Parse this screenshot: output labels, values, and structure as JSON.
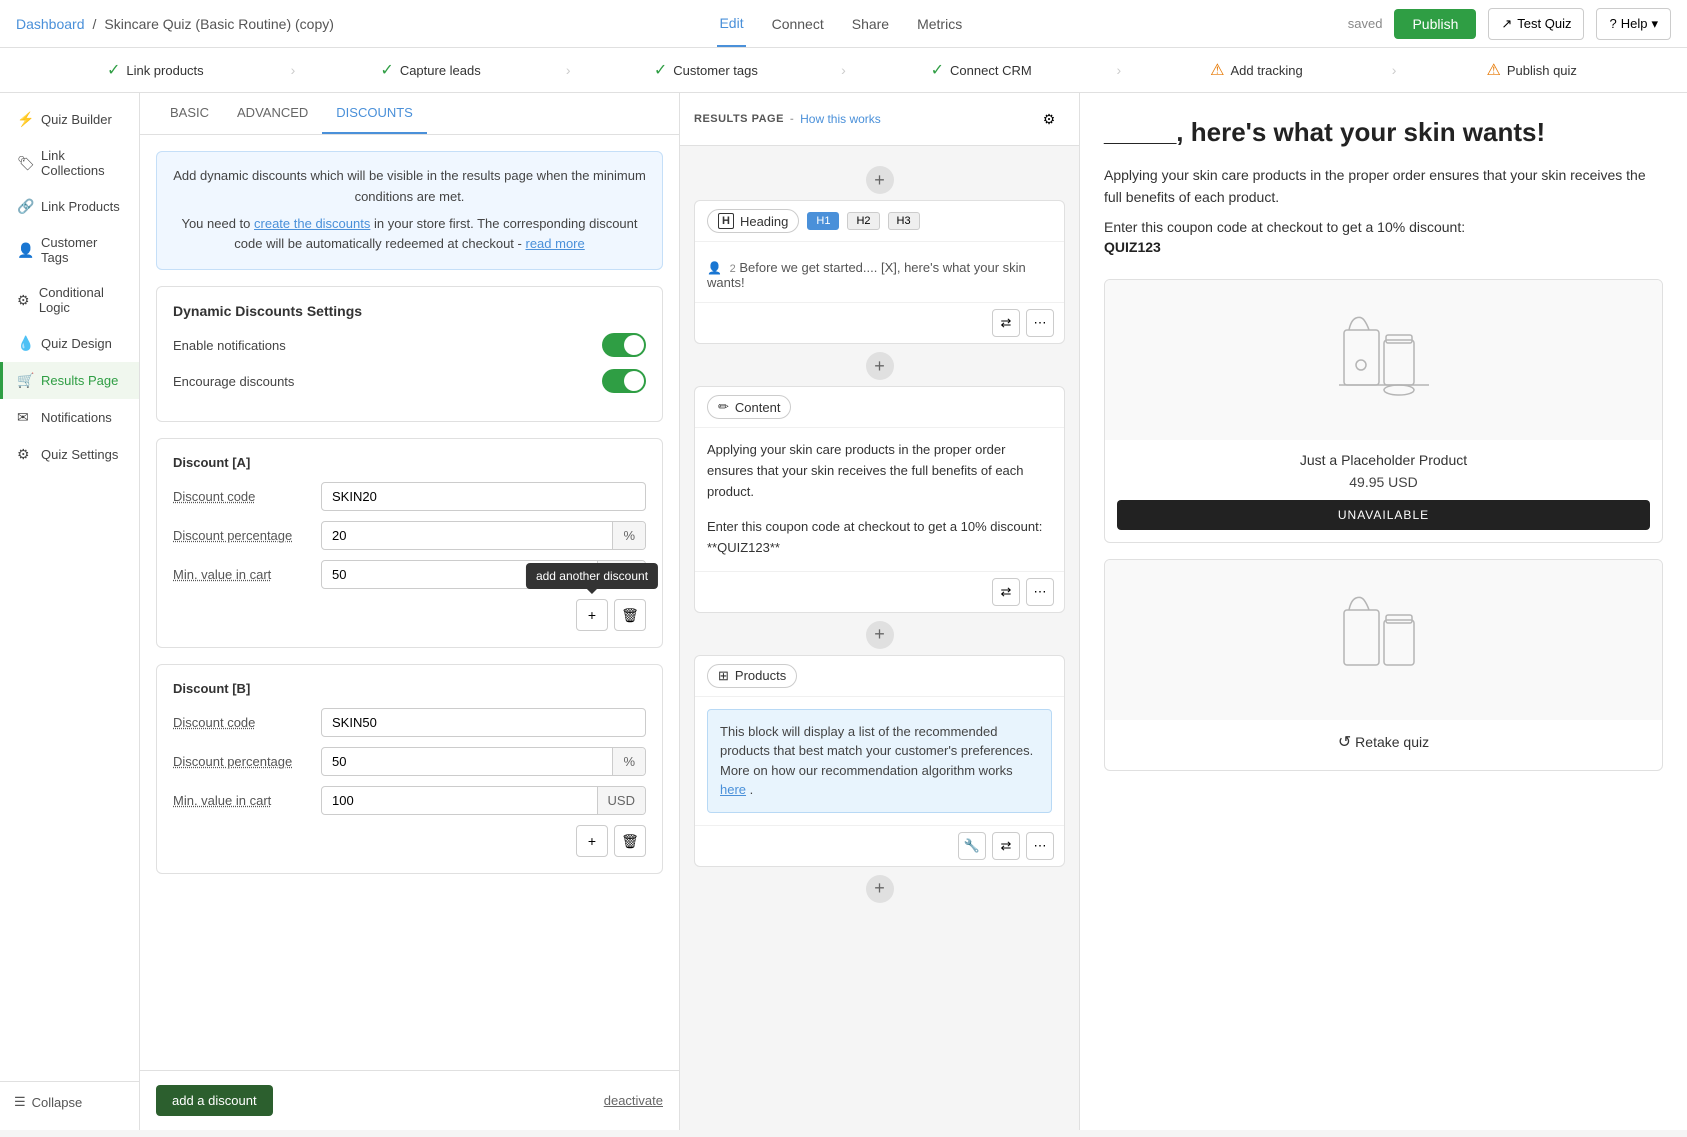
{
  "topNav": {
    "breadcrumb": {
      "dashboard": "Dashboard",
      "separator": "/",
      "title": "Skincare Quiz (Basic Routine) (copy)"
    },
    "tabs": [
      {
        "id": "edit",
        "label": "Edit",
        "active": true
      },
      {
        "id": "connect",
        "label": "Connect",
        "active": false
      },
      {
        "id": "share",
        "label": "Share",
        "active": false
      },
      {
        "id": "metrics",
        "label": "Metrics",
        "active": false
      }
    ],
    "savedLabel": "saved",
    "publishButton": "Publish",
    "testQuizButton": "Test Quiz",
    "helpButton": "Help"
  },
  "progressBar": [
    {
      "id": "link-products",
      "label": "Link products",
      "status": "green"
    },
    {
      "id": "capture-leads",
      "label": "Capture leads",
      "status": "green"
    },
    {
      "id": "customer-tags",
      "label": "Customer tags",
      "status": "green"
    },
    {
      "id": "connect-crm",
      "label": "Connect CRM",
      "status": "green"
    },
    {
      "id": "add-tracking",
      "label": "Add tracking",
      "status": "orange"
    },
    {
      "id": "publish-quiz",
      "label": "Publish quiz",
      "status": "orange"
    }
  ],
  "sidebar": {
    "items": [
      {
        "id": "quiz-builder",
        "label": "Quiz Builder",
        "icon": "⚡"
      },
      {
        "id": "link-collections",
        "label": "Link Collections",
        "icon": "🏷"
      },
      {
        "id": "link-products",
        "label": "Link Products",
        "icon": "🔗"
      },
      {
        "id": "customer-tags",
        "label": "Customer Tags",
        "icon": "👤"
      },
      {
        "id": "conditional-logic",
        "label": "Conditional Logic",
        "icon": "⚙"
      },
      {
        "id": "quiz-design",
        "label": "Quiz Design",
        "icon": "💧"
      },
      {
        "id": "results-page",
        "label": "Results Page",
        "icon": "🛒",
        "active": true
      },
      {
        "id": "notifications",
        "label": "Notifications",
        "icon": "✉"
      },
      {
        "id": "quiz-settings",
        "label": "Quiz Settings",
        "icon": "⚙"
      }
    ],
    "collapseLabel": "Collapse"
  },
  "leftPanel": {
    "tabs": [
      {
        "id": "basic",
        "label": "BASIC"
      },
      {
        "id": "advanced",
        "label": "ADVANCED"
      },
      {
        "id": "discounts",
        "label": "DISCOUNTS",
        "active": true
      }
    ],
    "infoBox": {
      "line1": "Add dynamic discounts which will be visible in the results page when the minimum conditions are met.",
      "line2": "You need to ",
      "link": "create the discounts",
      "line3": " in your store first. The corresponding discount code will be automatically redeemed at checkout - ",
      "readMore": "read more"
    },
    "dynamicDiscounts": {
      "title": "Dynamic Discounts Settings",
      "enableNotifications": "Enable notifications",
      "encourageDiscounts": "Encourage discounts"
    },
    "discountA": {
      "title": "Discount [A]",
      "codeLabel": "Discount code",
      "codeValue": "SKIN20",
      "percentLabel": "Discount percentage",
      "percentValue": "20",
      "minCartLabel": "Min. value in cart",
      "minCartValue": "50",
      "currencyLabel": "USD",
      "percentSuffix": "%"
    },
    "discountB": {
      "title": "Discount [B]",
      "codeLabel": "Discount code",
      "codeValue": "SKIN50",
      "percentLabel": "Discount percentage",
      "percentValue": "50",
      "minCartLabel": "Min. value in cart",
      "minCartValue": "100",
      "currencyLabel": "USD",
      "percentSuffix": "%"
    },
    "tooltip": "add another discount",
    "addDiscountButton": "add a discount",
    "deactivateButton": "deactivate"
  },
  "middlePanel": {
    "headerLabel": "RESULTS PAGE",
    "headerLink": "How this works",
    "blocks": [
      {
        "id": "heading",
        "type": "Heading",
        "hButtons": [
          "H1",
          "H2",
          "H3"
        ],
        "activeH": "H1",
        "preview": "Before we get started.... [X], here's what your skin wants!"
      },
      {
        "id": "content",
        "type": "Content",
        "text1": "Applying your skin care products in the proper order ensures that your skin receives the full benefits of each product.",
        "text2": "Enter this coupon code at checkout to get a 10% discount:",
        "text3": "**QUIZ123**"
      },
      {
        "id": "products",
        "type": "Products",
        "infoText": "This block will display a list of the recommended products that best match your customer's preferences. More on how our recommendation algorithm works ",
        "linkText": "here"
      }
    ]
  },
  "rightPanel": {
    "title": "_____, here's what your skin wants!",
    "desc1": "Applying your skin care products in the proper order ensures that your skin receives the full benefits of each product.",
    "couponLine": "Enter this coupon code at checkout to get a 10% discount:",
    "couponCode": "QUIZ123",
    "products": [
      {
        "name": "Just a Placeholder Product",
        "price": "49.95 USD",
        "buttonLabel": "UNAVAILABLE"
      },
      {
        "name": "Retake quiz",
        "price": "",
        "buttonLabel": ""
      }
    ]
  }
}
